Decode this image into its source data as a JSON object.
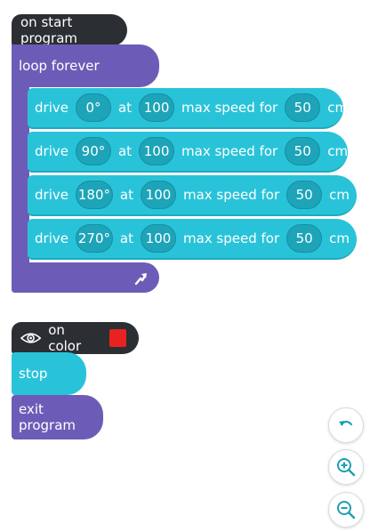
{
  "program": {
    "hat_label": "on start program",
    "loop_label": "loop forever",
    "drive_rows": [
      {
        "verb": "drive",
        "angle": "0°",
        "at": "at",
        "speed": "100",
        "max_label": "max speed for",
        "distance": "50",
        "unit": "cm"
      },
      {
        "verb": "drive",
        "angle": "90°",
        "at": "at",
        "speed": "100",
        "max_label": "max speed for",
        "distance": "50",
        "unit": "cm"
      },
      {
        "verb": "drive",
        "angle": "180°",
        "at": "at",
        "speed": "100",
        "max_label": "max speed for",
        "distance": "50",
        "unit": "cm"
      },
      {
        "verb": "drive",
        "angle": "270°",
        "at": "at",
        "speed": "100",
        "max_label": "max speed for",
        "distance": "50",
        "unit": "cm"
      }
    ],
    "loop_return_icon": "loop-arrow-icon"
  },
  "color_event": {
    "hat_label": "on color",
    "eye_icon": "eye-icon",
    "swatch_color": "#e8231f",
    "stop_label": "stop",
    "exit_label": "exit program"
  },
  "controls": {
    "undo_icon": "undo-icon",
    "zoom_in_icon": "zoom-in-icon",
    "zoom_out_icon": "zoom-out-icon"
  },
  "colors": {
    "hat": "#2b2e33",
    "loop": "#6d5cb7",
    "motion": "#29c3d9",
    "accent": "#1e9fb3"
  }
}
